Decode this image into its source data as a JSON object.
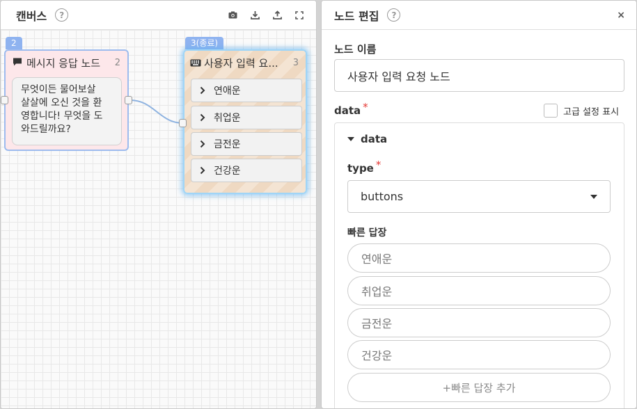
{
  "canvas": {
    "title": "캔버스",
    "help_symbol": "?",
    "toolbar_icons": [
      "camera-icon",
      "download-icon",
      "upload-icon",
      "fullscreen-icon"
    ],
    "nodes": [
      {
        "tag": "2",
        "icon": "speech-bubble-icon",
        "title": "메시지 응답 노드",
        "number": "2",
        "message_lines": [
          "무엇이든 물어보살",
          "살살에 오신 것을 환",
          "영합니다! 무엇을 도",
          "와드릴까요?"
        ],
        "color": "#fde7ea"
      },
      {
        "tag": "3(종료)",
        "icon": "keyboard-icon",
        "title": "사용자 입력 요...",
        "number": "3",
        "buttons": [
          "연애운",
          "취업운",
          "금전운",
          "건강운"
        ],
        "color": "#f4e4d3"
      }
    ]
  },
  "edit": {
    "title": "노드 편집",
    "help_symbol": "?",
    "close_symbol": "×",
    "name_label": "노드 이름",
    "name_value": "사용자 입력 요청 노드",
    "data_label": "data",
    "required_mark": "*",
    "advanced_label": "고급 설정 표시",
    "data_section_title": "data",
    "type_label": "type",
    "type_value": "buttons",
    "quick_reply_label": "빠른 답장",
    "quick_replies": [
      "연애운",
      "취업운",
      "금전운",
      "건강운"
    ],
    "add_quick_reply": "+빠른 답장 추가"
  },
  "colors": {
    "accent_tag": "#8fb3f0",
    "required": "#e53935",
    "glow": "#9fd5f7"
  }
}
